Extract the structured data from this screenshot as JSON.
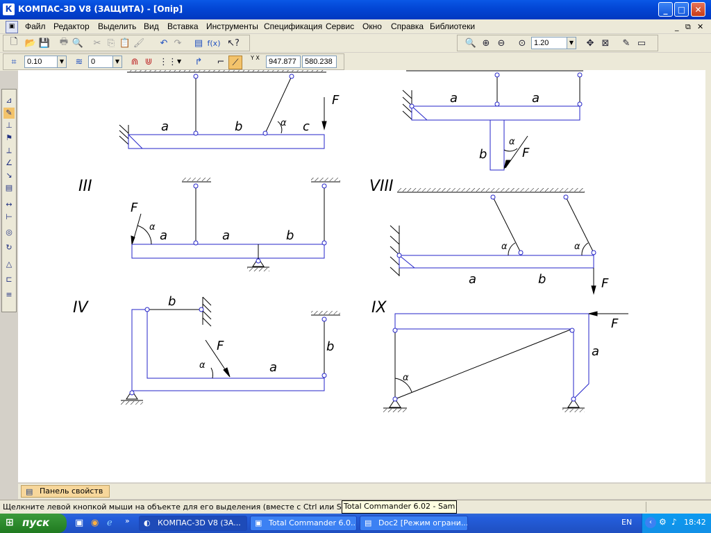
{
  "window": {
    "title": "КОМПАС-3D V8 (ЗАЩИТА) - [Опір]",
    "app_icon_glyph": "К",
    "minimize_glyph": "_",
    "maximize_glyph": "□",
    "close_glyph": "✕",
    "doc_min_glyph": "_",
    "doc_restore_glyph": "⧉",
    "doc_close_glyph": "✕"
  },
  "menu": {
    "items": [
      "Файл",
      "Редактор",
      "Выделить",
      "Вид",
      "Вставка",
      "Инструменты",
      "Спецификация",
      "Сервис",
      "Окно",
      "Справка",
      "Библиотеки"
    ]
  },
  "toolbar": {
    "zoom_value": "1.20",
    "step_value": "0.10",
    "layer_value": "0",
    "coord_x": "947.877",
    "coord_y": "580.238",
    "coord_label": "Y X"
  },
  "drawing": {
    "labels": {
      "III": "III",
      "IV": "IV",
      "VIII": "VIII",
      "IX": "IX",
      "F": "F",
      "a": "a",
      "b": "b",
      "c": "c",
      "alpha": "α"
    }
  },
  "props_panel": {
    "tab_label": "Панель свойств"
  },
  "status": {
    "text": "Щелкните левой кнопкой мыши на объекте для его выделения (вместе с Ctrl или Shift - добави",
    "tooltip": "Total Commander 6.02 - Sam"
  },
  "taskbar": {
    "start_label": "пуск",
    "tasks": [
      "КОМПАС-3D V8 (ЗА...",
      "Total Commander 6.0...",
      "Doc2 [Режим ограни..."
    ],
    "lang": "EN",
    "clock": "18:42"
  },
  "colors": {
    "accent": "#0a58e6",
    "drawing_blue": "#2323c8",
    "taskbar": "#245edc"
  }
}
